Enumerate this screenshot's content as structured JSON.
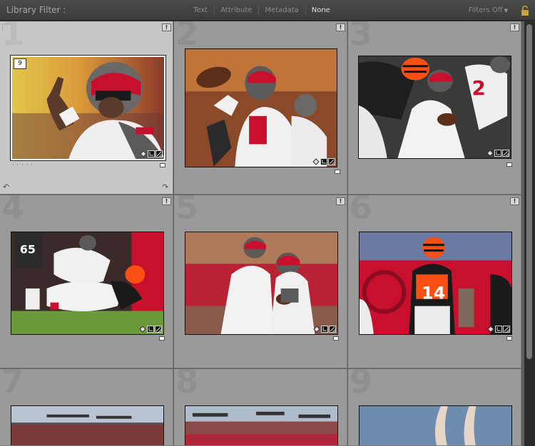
{
  "filter_bar": {
    "title": "Library Filter :",
    "options": [
      "Text",
      "Attribute",
      "Metadata",
      "None"
    ],
    "active": "None",
    "filters_off": "Filters Off"
  },
  "grid": {
    "cells": [
      {
        "index": "1",
        "selected": true,
        "stack_count": "9"
      },
      {
        "index": "2"
      },
      {
        "index": "3"
      },
      {
        "index": "4"
      },
      {
        "index": "5"
      },
      {
        "index": "6"
      },
      {
        "index": "7"
      },
      {
        "index": "8"
      },
      {
        "index": "9"
      }
    ],
    "flag_glyph": "!"
  },
  "colors": {
    "bucs_red": "#c8102e",
    "pewter": "#5c5a58",
    "bengals_orange": "#fb4f14",
    "field_green": "#6a9a3a"
  }
}
